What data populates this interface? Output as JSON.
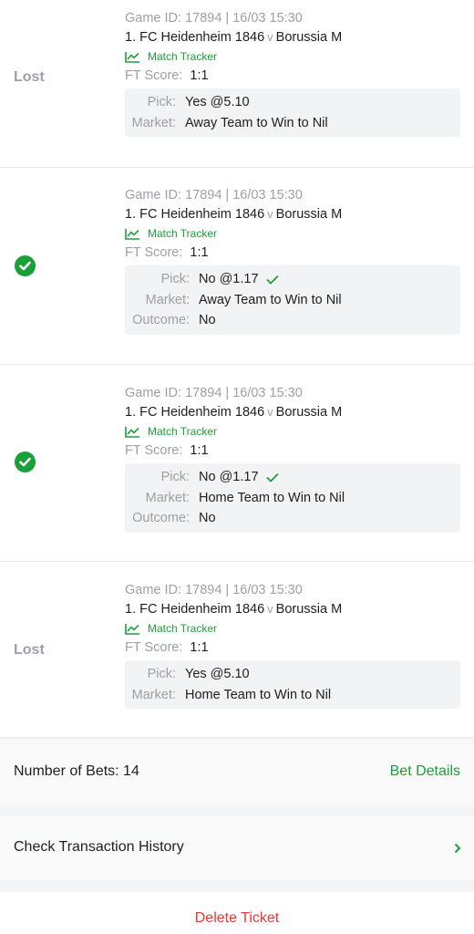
{
  "bets": [
    {
      "status": "Lost",
      "game_id": "Game ID: 17894 | 16/03 15:30",
      "home": "1. FC Heidenheim 1846",
      "vs": "v",
      "away": "Borussia M",
      "tracker": "Match Tracker",
      "ft_label": "FT Score:",
      "ft_score": "1:1",
      "pick_label": "Pick:",
      "pick": "Yes @5.10",
      "market_label": "Market:",
      "market": "Away Team to Win to Nil"
    },
    {
      "status": "won",
      "game_id": "Game ID: 17894 | 16/03 15:30",
      "home": "1. FC Heidenheim 1846",
      "vs": "v",
      "away": "Borussia M",
      "tracker": "Match Tracker",
      "ft_label": "FT Score:",
      "ft_score": "1:1",
      "pick_label": "Pick:",
      "pick": "No @1.17",
      "market_label": "Market:",
      "market": "Away Team to Win to Nil",
      "outcome_label": "Outcome:",
      "outcome": "No"
    },
    {
      "status": "won",
      "game_id": "Game ID: 17894 | 16/03 15:30",
      "home": "1. FC Heidenheim 1846",
      "vs": "v",
      "away": "Borussia M",
      "tracker": "Match Tracker",
      "ft_label": "FT Score:",
      "ft_score": "1:1",
      "pick_label": "Pick:",
      "pick": "No @1.17",
      "market_label": "Market:",
      "market": "Home Team to Win to Nil",
      "outcome_label": "Outcome:",
      "outcome": "No"
    },
    {
      "status": "Lost",
      "game_id": "Game ID: 17894 | 16/03 15:30",
      "home": "1. FC Heidenheim 1846",
      "vs": "v",
      "away": "Borussia M",
      "tracker": "Match Tracker",
      "ft_label": "FT Score:",
      "ft_score": "1:1",
      "pick_label": "Pick:",
      "pick": "Yes @5.10",
      "market_label": "Market:",
      "market": "Home Team to Win to Nil"
    }
  ],
  "summary": {
    "number_of_bets": "Number of Bets: 14",
    "bet_details": "Bet Details"
  },
  "transaction": {
    "label": "Check Transaction History",
    "icon": "chevron-right-icon"
  },
  "delete": {
    "label": "Delete Ticket"
  },
  "colors": {
    "green": "#1aa038",
    "grey_text": "#9ca0a6",
    "red": "#e53935"
  }
}
